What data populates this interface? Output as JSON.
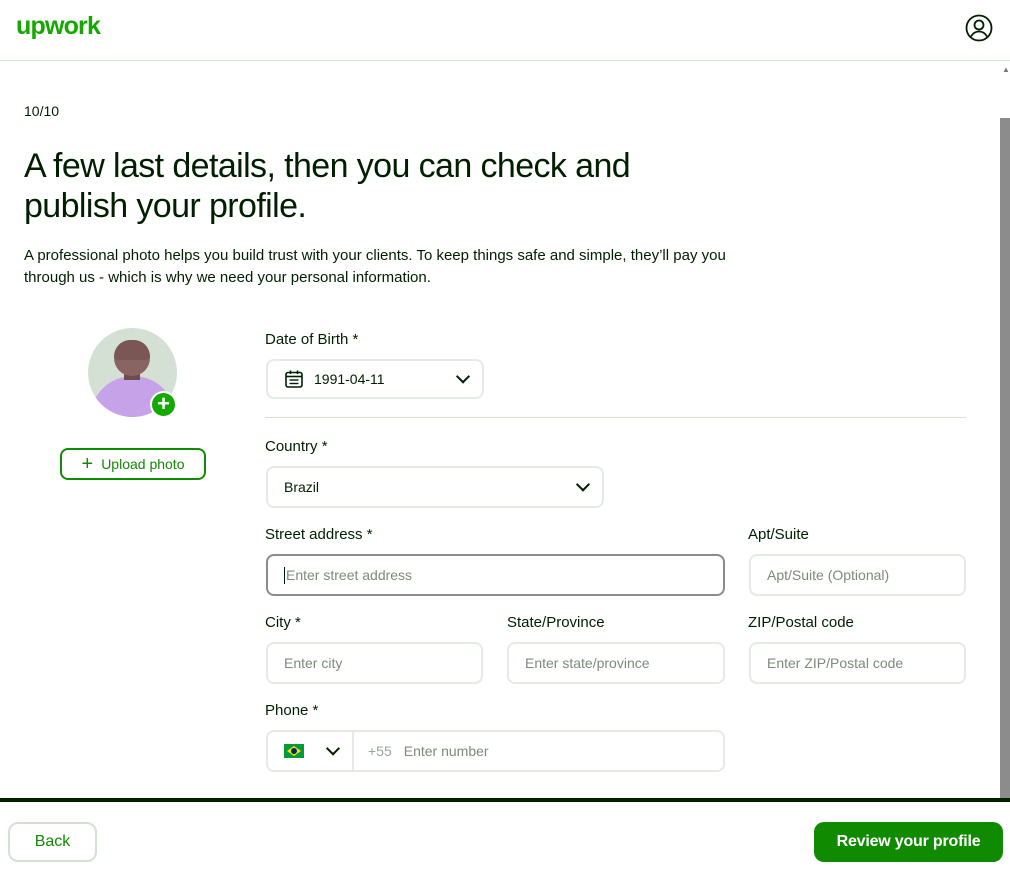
{
  "header": {
    "logo_text": "upwork",
    "account_icon": "user-circle-icon"
  },
  "progress": {
    "step_text": "10/10"
  },
  "main": {
    "title": "A few last details, then you can check and publish your profile.",
    "description": "A professional photo helps you build trust with your clients. To keep things safe and simple, they’ll pay you through us - which is why we need your personal information."
  },
  "photo": {
    "upload_label": "Upload photo",
    "add_icon": "plus-circle-icon"
  },
  "form": {
    "dob": {
      "label": "Date of Birth *",
      "value": "1991-04-11",
      "icon": "calendar-icon"
    },
    "country": {
      "label": "Country *",
      "value": "Brazil"
    },
    "street": {
      "label": "Street address *",
      "placeholder": "Enter street address"
    },
    "apt": {
      "label": "Apt/Suite",
      "placeholder": "Apt/Suite (Optional)"
    },
    "city": {
      "label": "City *",
      "placeholder": "Enter city"
    },
    "state": {
      "label": "State/Province",
      "placeholder": "Enter state/province"
    },
    "zip": {
      "label": "ZIP/Postal code",
      "placeholder": "Enter ZIP/Postal code"
    },
    "phone": {
      "label": "Phone *",
      "country_code": "+55",
      "placeholder": "Enter number",
      "flag": "brazil-flag-icon"
    }
  },
  "footer": {
    "back_label": "Back",
    "review_label": "Review your profile"
  },
  "colors": {
    "brand_green": "#14a800",
    "button_green": "#108a00",
    "text": "#001e00"
  }
}
